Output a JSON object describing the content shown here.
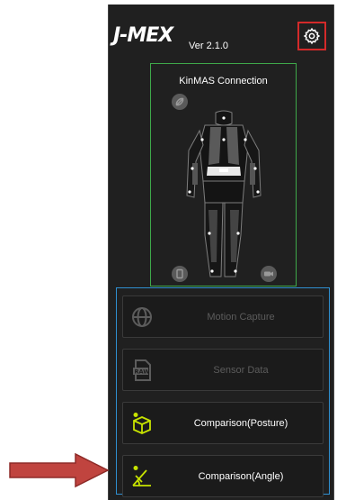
{
  "header": {
    "logo": "J-MEX",
    "version": "Ver 2.1.0"
  },
  "connection": {
    "title": "KinMAS  Connection"
  },
  "menu": {
    "items": [
      {
        "label": "Motion Capture",
        "enabled": false
      },
      {
        "label": "Sensor Data",
        "enabled": false
      },
      {
        "label": "Comparison(Posture)",
        "enabled": true
      },
      {
        "label": "Comparison(Angle)",
        "enabled": true
      }
    ]
  },
  "colors": {
    "panel_bg": "#202020",
    "settings_highlight": "#d42a2a",
    "connection_border": "#3ea84a",
    "menu_border": "#2f8fd0",
    "accent_icon": "#c7e300",
    "pointer_arrow": "#c0443f"
  },
  "icons": {
    "settings": "gear-icon",
    "link": "link-off-icon",
    "motion_capture": "globe-icon",
    "sensor_data": "raw-file-icon",
    "posture": "cube-icon",
    "angle": "angle-icon"
  }
}
